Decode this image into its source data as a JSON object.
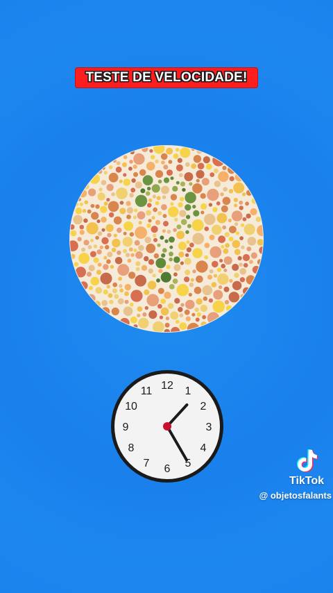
{
  "title": {
    "text": "TESTE DE VELOCIDADE!",
    "background_color": "#ff1e1e"
  },
  "plate": {
    "hidden_symbol": "?",
    "dot_colors_background": [
      "#e8a07a",
      "#f2c14e",
      "#d9854e",
      "#f0d070",
      "#c76b4a",
      "#f5b06a",
      "#e9c38d",
      "#d86f50",
      "#f7d34a"
    ],
    "dot_colors_figure": [
      "#5f8a3a",
      "#8fa84e",
      "#6a9440",
      "#a9b45a",
      "#4e7a32"
    ]
  },
  "clock": {
    "numbers": [
      "12",
      "1",
      "2",
      "3",
      "4",
      "5",
      "6",
      "7",
      "8",
      "9",
      "10",
      "11"
    ],
    "hour": 1,
    "minute": 25
  },
  "watermark": {
    "brand": "TikTok",
    "handle": "@ objetosfalants",
    "icon": "tiktok-note-icon"
  }
}
